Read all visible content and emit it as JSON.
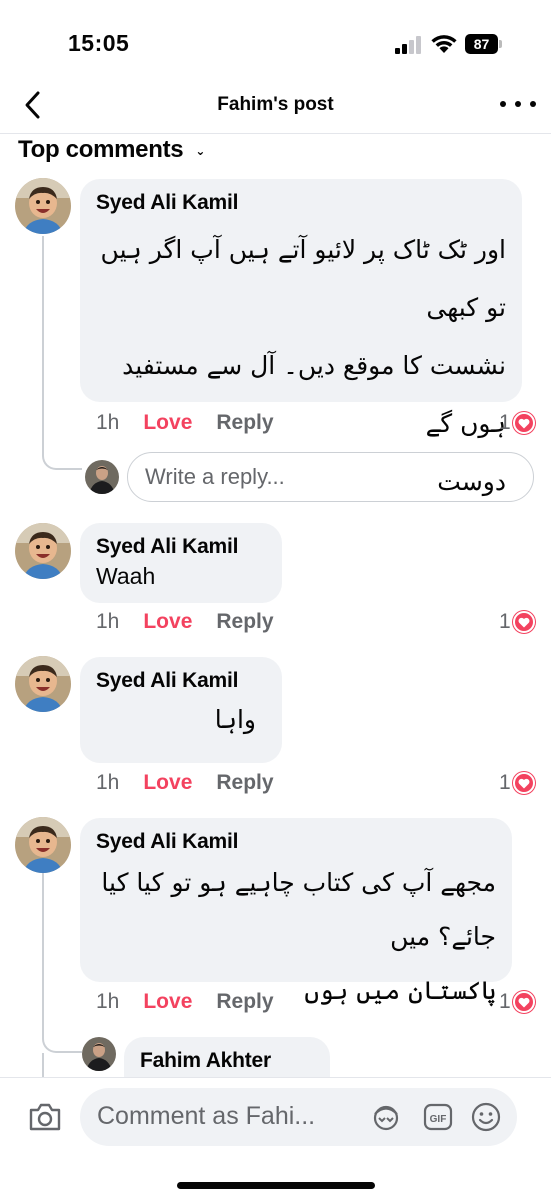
{
  "status_bar": {
    "time": "15:05",
    "battery": "87"
  },
  "header": {
    "title": "Fahim's post"
  },
  "sort": {
    "label": "Top comments"
  },
  "comments": [
    {
      "author": "Syed Ali Kamil",
      "text": [
        "اور ٹک ٹاک پر لائیو آتے ہیں آپ اگر ہیں تو کبھی",
        "نشست کا موقع دیں۔ آل سے مستفید ہوں گے",
        "دوست"
      ],
      "time": "1h",
      "love": "Love",
      "reply": "Reply",
      "reactions": "1"
    },
    {
      "author": "Syed Ali Kamil",
      "text": "Waah",
      "time": "1h",
      "love": "Love",
      "reply": "Reply",
      "reactions": "1"
    },
    {
      "author": "Syed Ali Kamil",
      "text": "واہا",
      "time": "1h",
      "love": "Love",
      "reply": "Reply",
      "reactions": "1"
    },
    {
      "author": "Syed Ali Kamil",
      "text": [
        "مجھے آپ کی کتاب چاہیے ہو تو کیا کیا جائے؟ میں",
        "پاکستان میں ہوں"
      ],
      "time": "1h",
      "love": "Love",
      "reply": "Reply",
      "reactions": "1"
    }
  ],
  "reply_box": {
    "placeholder": "Write a reply..."
  },
  "nested_reply": {
    "author": "Fahim Akhter"
  },
  "comment_bar": {
    "placeholder": "Comment as Fahi..."
  },
  "icons": {
    "back": "chevron-left-icon",
    "more": "more-horizontal-icon",
    "camera": "camera-icon",
    "avatar": "avatar-sticker-icon",
    "gif": "gif-icon",
    "emoji": "emoji-icon",
    "heart": "heart-reaction-icon"
  },
  "colors": {
    "love": "#f3425f",
    "bubble": "#f0f2f5",
    "meta": "#65676b"
  }
}
